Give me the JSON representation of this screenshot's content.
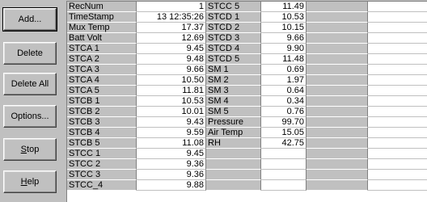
{
  "buttons": {
    "add": "Add...",
    "delete": "Delete",
    "delete_all": "Delete All",
    "options": "Options...",
    "stop": "Stop",
    "help": "Help"
  },
  "table1": [
    {
      "label": "RecNum",
      "value": "1"
    },
    {
      "label": "TimeStamp",
      "value": "13 12:35:26"
    },
    {
      "label": "Mux Temp",
      "value": "17.37"
    },
    {
      "label": "Batt Volt",
      "value": "12.69"
    },
    {
      "label": "STCA 1",
      "value": "9.45"
    },
    {
      "label": "STCA 2",
      "value": "9.48"
    },
    {
      "label": "STCA 3",
      "value": "9.66"
    },
    {
      "label": "STCA 4",
      "value": "10.50"
    },
    {
      "label": "STCA 5",
      "value": "11.81"
    },
    {
      "label": "STCB 1",
      "value": "10.53"
    },
    {
      "label": "STCB 2",
      "value": "10.01"
    },
    {
      "label": "STCB 3",
      "value": "9.43"
    },
    {
      "label": "STCB 4",
      "value": "9.59"
    },
    {
      "label": "STCB 5",
      "value": "11.08"
    },
    {
      "label": "STCC 1",
      "value": "9.45"
    },
    {
      "label": "STCC 2",
      "value": "9.36"
    },
    {
      "label": "STCC 3",
      "value": "9.36"
    },
    {
      "label": "STCC_4",
      "value": "9.88"
    }
  ],
  "table2": [
    {
      "label": "STCC 5",
      "value": "11.49"
    },
    {
      "label": "STCD 1",
      "value": "10.53"
    },
    {
      "label": "STCD 2",
      "value": "10.15"
    },
    {
      "label": "STCD 3",
      "value": "9.66"
    },
    {
      "label": "STCD 4",
      "value": "9.90"
    },
    {
      "label": "STCD 5",
      "value": "11.48"
    },
    {
      "label": "SM 1",
      "value": "0.69"
    },
    {
      "label": "SM 2",
      "value": "1.97"
    },
    {
      "label": "SM 3",
      "value": "0.64"
    },
    {
      "label": "SM 4",
      "value": "0.34"
    },
    {
      "label": "SM 5",
      "value": "0.76"
    },
    {
      "label": "Pressure",
      "value": "99.70"
    },
    {
      "label": "Air Temp",
      "value": "15.05"
    },
    {
      "label": "RH",
      "value": "42.75"
    }
  ]
}
